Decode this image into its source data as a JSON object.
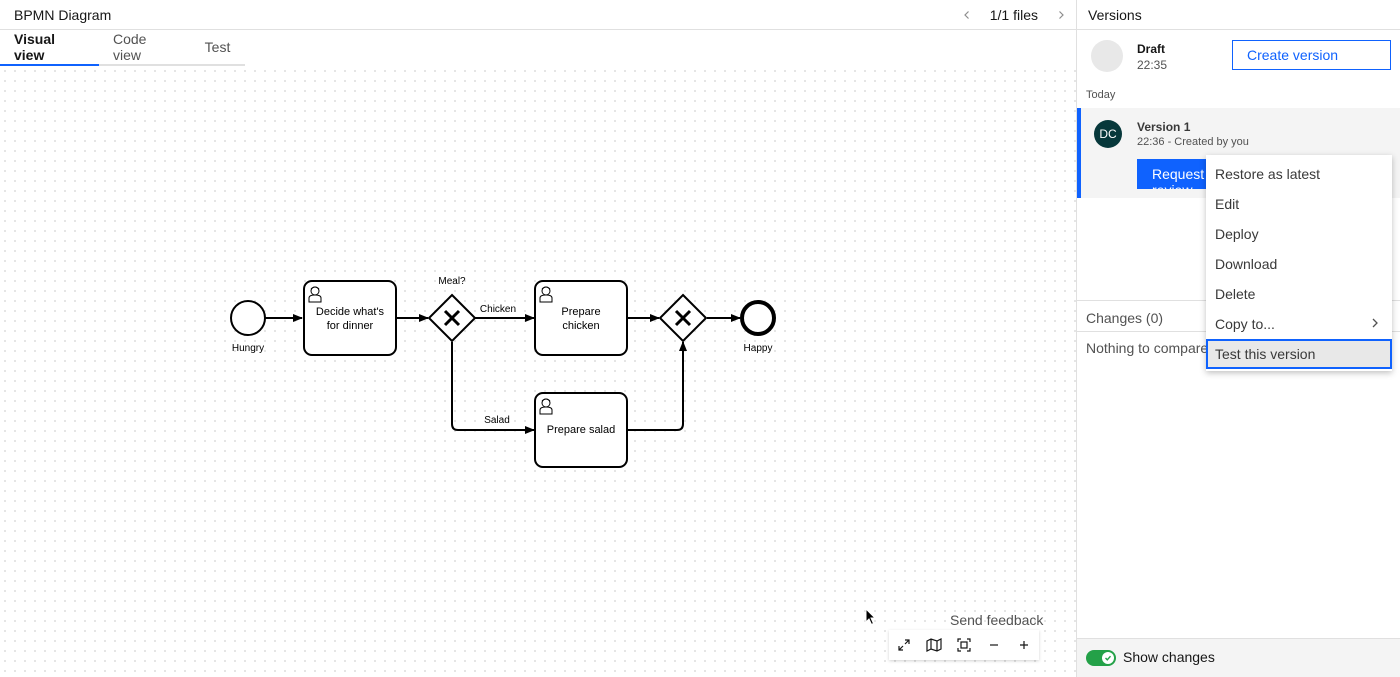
{
  "editor": {
    "title": "BPMN Diagram",
    "files_count": "1/1 files",
    "tabs": [
      {
        "label": "Visual view"
      },
      {
        "label": "Code view"
      },
      {
        "label": "Test"
      }
    ],
    "send_feedback": "Send feedback",
    "zoom_controls": [
      "fullscreen-icon",
      "minimap-icon",
      "fit-to-view-icon",
      "zoom-out-icon",
      "zoom-in-icon"
    ]
  },
  "diagram": {
    "start_event": "Hungry",
    "task_decide": [
      "Decide what's",
      "for dinner"
    ],
    "gateway_label": "Meal?",
    "flow_chicken": "Chicken",
    "flow_salad": "Salad",
    "task_chicken": [
      "Prepare",
      "chicken"
    ],
    "task_salad": "Prepare salad",
    "end_event": "Happy"
  },
  "versions": {
    "header": "Versions",
    "draft": {
      "name": "Draft",
      "time": "22:35"
    },
    "create_button": "Create version",
    "today_label": "Today",
    "version": {
      "avatar": "DC",
      "name": "Version 1",
      "meta": "22:36 - Created by you"
    },
    "request_button": "Request review",
    "changes_label": "Changes (0)",
    "nothing_label": "Nothing to compare",
    "show_changes": "Show changes",
    "show_changes_on": true
  },
  "menu": {
    "items": [
      {
        "label": "Restore as latest"
      },
      {
        "label": "Edit"
      },
      {
        "label": "Deploy"
      },
      {
        "label": "Download"
      },
      {
        "label": "Delete"
      },
      {
        "label": "Copy to..."
      },
      {
        "label": "Test this version"
      }
    ]
  },
  "colors": {
    "accent": "#0f62fe",
    "toggle_on": "#24a148",
    "avatar_bg": "#07383b"
  }
}
